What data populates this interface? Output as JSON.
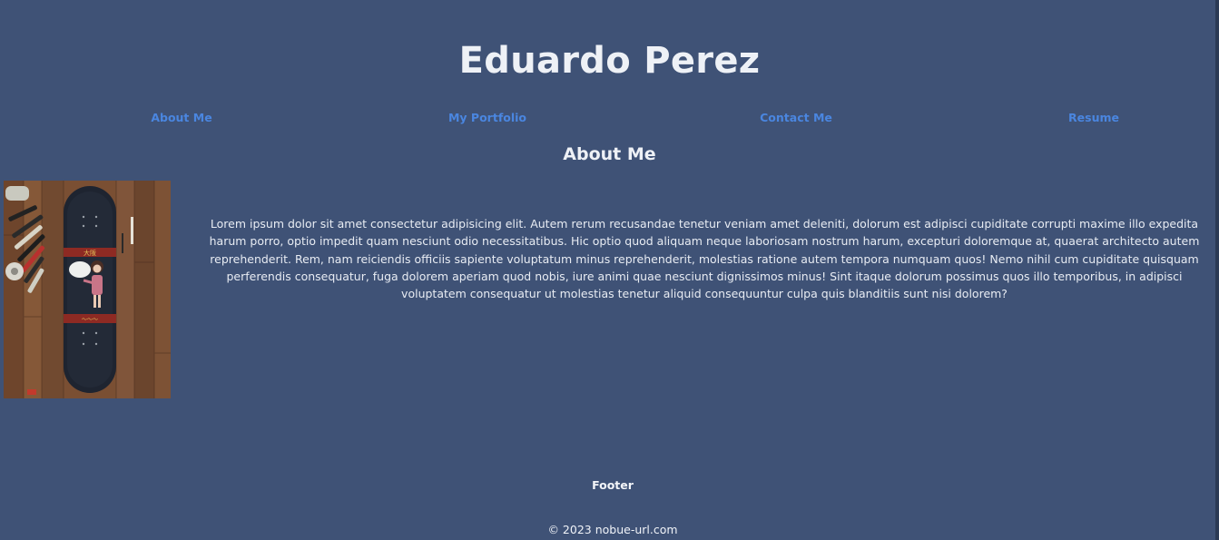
{
  "header": {
    "title": "Eduardo Perez"
  },
  "nav": {
    "items": [
      {
        "label": "About Me"
      },
      {
        "label": "My Portfolio"
      },
      {
        "label": "Contact Me"
      },
      {
        "label": "Resume"
      }
    ]
  },
  "about": {
    "heading": "About Me",
    "image_alt": "skateboard-photo",
    "text": "Lorem ipsum dolor sit amet consectetur adipisicing elit. Autem rerum recusandae tenetur veniam amet deleniti, dolorum est adipisci cupiditate corrupti maxime illo expedita harum porro, optio impedit quam nesciunt odio necessitatibus. Hic optio quod aliquam neque laboriosam nostrum harum, excepturi doloremque at, quaerat architecto autem reprehenderit. Rem, nam reiciendis officiis sapiente voluptatum minus reprehenderit, molestias ratione autem tempora numquam quos! Nemo nihil cum cupiditate quisquam perferendis consequatur, fuga dolorem aperiam quod nobis, iure animi quae nesciunt dignissimos minus! Sint itaque dolorum possimus quos illo temporibus, in adipisci voluptatem consequatur ut molestias tenetur aliquid consequuntur culpa quis blanditiis sunt nisi dolorem?"
  },
  "footer": {
    "title": "Footer",
    "copyright": "© 2023 nobue-url.com"
  },
  "colors": {
    "background": "#3f5276",
    "link": "#4a86e0",
    "text": "#eef1f6"
  }
}
